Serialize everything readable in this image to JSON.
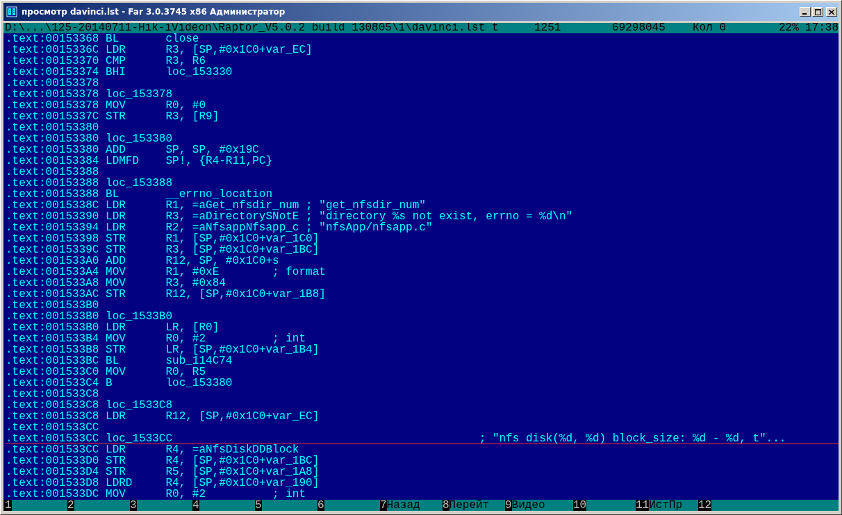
{
  "window": {
    "title": "просмотр davinci.lst - Far 3.0.3745 x86 Администратор"
  },
  "status_bar": {
    "path": "D:\\...\\125-20140711-Hik-iVideon\\Raptor_V5.0.2 build 130805\\1\\davinci.lst t",
    "codepage": "1251",
    "size": "69298045",
    "column": "Кол 0",
    "percent": "22%",
    "clock": "17:38"
  },
  "lines": [
    {
      "text": ".text:00153368 BL       close",
      "underlined": false
    },
    {
      "text": ".text:0015336C LDR      R3, [SP,#0x1C0+var_EC]",
      "underlined": false
    },
    {
      "text": ".text:00153370 CMP      R3, R6",
      "underlined": false
    },
    {
      "text": ".text:00153374 BHI      loc_153330",
      "underlined": false
    },
    {
      "text": ".text:00153378",
      "underlined": false
    },
    {
      "text": ".text:00153378 loc_153378",
      "underlined": false
    },
    {
      "text": ".text:00153378 MOV      R0, #0",
      "underlined": false
    },
    {
      "text": ".text:0015337C STR      R3, [R9]",
      "underlined": false
    },
    {
      "text": ".text:00153380",
      "underlined": false
    },
    {
      "text": ".text:00153380 loc_153380",
      "underlined": false
    },
    {
      "text": ".text:00153380 ADD      SP, SP, #0x19C",
      "underlined": false
    },
    {
      "text": ".text:00153384 LDMFD    SP!, {R4-R11,PC}",
      "underlined": false
    },
    {
      "text": ".text:00153388",
      "underlined": false
    },
    {
      "text": ".text:00153388 loc_153388",
      "underlined": false
    },
    {
      "text": ".text:00153388 BL       __errno_location",
      "underlined": false
    },
    {
      "text": ".text:0015338C LDR      R1, =aGet_nfsdir_num ; \"get_nfsdir_num\"",
      "underlined": false
    },
    {
      "text": ".text:00153390 LDR      R3, =aDirectorySNotE ; \"directory %s not exist, errno = %d\\n\"",
      "underlined": false
    },
    {
      "text": ".text:00153394 LDR      R2, =aNfsappNfsapp_c ; \"nfsApp/nfsapp.c\"",
      "underlined": false
    },
    {
      "text": ".text:00153398 STR      R1, [SP,#0x1C0+var_1C0]",
      "underlined": false
    },
    {
      "text": ".text:0015339C STR      R3, [SP,#0x1C0+var_1BC]",
      "underlined": false
    },
    {
      "text": ".text:001533A0 ADD      R12, SP, #0x1C0+s",
      "underlined": false
    },
    {
      "text": ".text:001533A4 MOV      R1, #0xE        ; format",
      "underlined": false
    },
    {
      "text": ".text:001533A8 MOV      R3, #0x84",
      "underlined": false
    },
    {
      "text": ".text:001533AC STR      R12, [SP,#0x1C0+var_1B8]",
      "underlined": false
    },
    {
      "text": ".text:001533B0",
      "underlined": false
    },
    {
      "text": ".text:001533B0 loc_1533B0",
      "underlined": false
    },
    {
      "text": ".text:001533B0 LDR      LR, [R0]",
      "underlined": false
    },
    {
      "text": ".text:001533B4 MOV      R0, #2          ; int",
      "underlined": false
    },
    {
      "text": ".text:001533B8 STR      LR, [SP,#0x1C0+var_1B4]",
      "underlined": false
    },
    {
      "text": ".text:001533BC BL       sub_114C74",
      "underlined": false
    },
    {
      "text": ".text:001533C0 MOV      R0, R5",
      "underlined": false
    },
    {
      "text": ".text:001533C4 B        loc_153380",
      "underlined": false
    },
    {
      "text": ".text:001533C8",
      "underlined": false
    },
    {
      "text": ".text:001533C8 loc_1533C8",
      "underlined": false
    },
    {
      "text": ".text:001533C8 LDR      R12, [SP,#0x1C0+var_EC]",
      "underlined": false
    },
    {
      "text": ".text:001533CC",
      "underlined": false
    },
    {
      "text": ".text:001533CC loc_1533CC                                              ; \"nfs disk(%d, %d) block_size: %d - %d, t\"...",
      "underlined": true
    },
    {
      "text": ".text:001533CC LDR      R4, =aNfsDiskDDBlock",
      "underlined": false
    },
    {
      "text": ".text:001533D0 STR      R4, [SP,#0x1C0+var_1BC]",
      "underlined": false
    },
    {
      "text": ".text:001533D4 STR      R5, [SP,#0x1C0+var_1A8]",
      "underlined": false
    },
    {
      "text": ".text:001533D8 LDRD     R4, [SP,#0x1C0+var_190]",
      "underlined": false
    },
    {
      "text": ".text:001533DC MOV      R0, #2          ; int",
      "underlined": false
    }
  ],
  "keybar": [
    {
      "key": "1"
    },
    {
      "key": "2"
    },
    {
      "key": "3"
    },
    {
      "key": "4"
    },
    {
      "key": "5"
    },
    {
      "key": "6"
    },
    {
      "key": "7",
      "label": "Назад"
    },
    {
      "key": "8",
      "label": "Перейт"
    },
    {
      "key": "9",
      "label": "Видео"
    },
    {
      "key": "10"
    },
    {
      "key": "11",
      "label": "ИстПр"
    },
    {
      "key": "12"
    }
  ]
}
